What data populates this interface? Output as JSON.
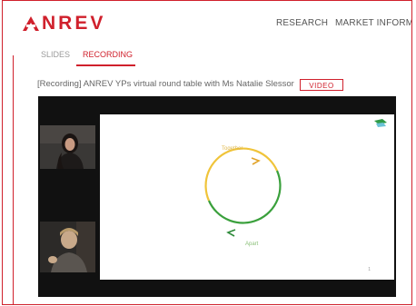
{
  "header": {
    "logo_text": "NREV",
    "logo_alt": "ANREV",
    "brand_color": "#d0202c",
    "nav": [
      "RESEARCH",
      "MARKET INFORMATIC"
    ]
  },
  "tabs": [
    {
      "label": "SLIDES",
      "active": false
    },
    {
      "label": "RECORDING",
      "active": true
    }
  ],
  "recording": {
    "title": "[Recording] ANREV YPs virtual round table with Ms Natalie Slessor",
    "badge": "VIDEO"
  },
  "slide": {
    "cycle_top_label": "Together",
    "cycle_bottom_label": "Apart",
    "cycle_colors": [
      "#f0c43a",
      "#3aa03c"
    ],
    "page_number": "1"
  },
  "participants": [
    {
      "name": "participant-1"
    },
    {
      "name": "participant-2"
    }
  ]
}
